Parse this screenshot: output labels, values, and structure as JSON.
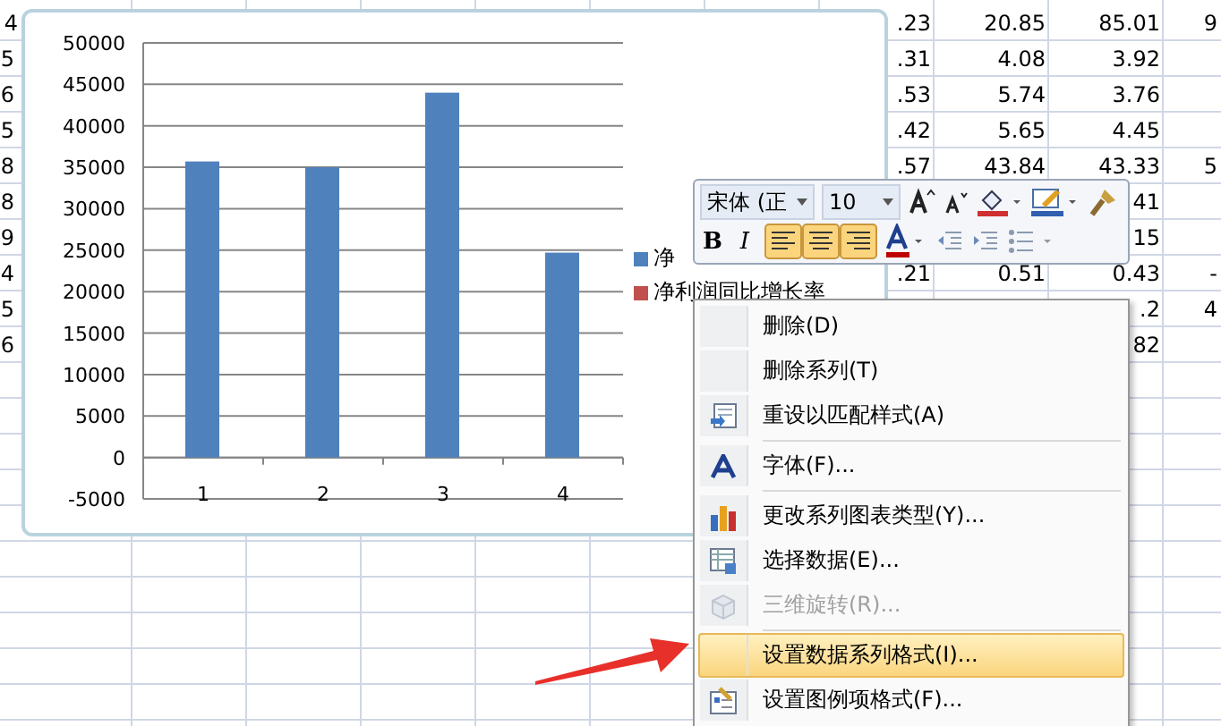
{
  "sheet": {
    "rows": [
      {
        "column_1": "4",
        "column_2": ".23",
        "column_3": "20.85",
        "column_4": "85.01",
        "column_5": "9"
      },
      {
        "column_1": "5",
        "column_2": ".31",
        "column_3": "4.08",
        "column_4": "3.92"
      },
      {
        "column_1": "6",
        "column_2": ".53",
        "column_3": "5.74",
        "column_4": "3.76"
      },
      {
        "column_1": "5",
        "column_2": ".42",
        "column_3": "5.65",
        "column_4": "4.45"
      },
      {
        "column_1": "8",
        "column_2": ".57",
        "column_3": "43.84",
        "column_4": "43.33",
        "column_5": "5"
      },
      {
        "column_1": "8",
        "column_4": "41"
      },
      {
        "column_1": "9",
        "column_4": "15"
      },
      {
        "column_1": "4",
        "column_2": ".21",
        "column_3": "0.51",
        "column_4": "0.43",
        "column_5": "-"
      },
      {
        "column_1": "5",
        "column_4": ".2",
        "column_5": "4"
      },
      {
        "column_1": "6",
        "column_4": "82"
      }
    ]
  },
  "chart": {
    "chart_data": {
      "type": "bar",
      "grid": true,
      "categories": [
        "1",
        "2",
        "3",
        "4"
      ],
      "series": [
        {
          "name": "净",
          "color": "#4f81bd",
          "values": [
            35700,
            35000,
            44000,
            24700
          ]
        },
        {
          "name": "净利润同比增长率",
          "color": "#c0504d",
          "values": [
            null,
            null,
            null,
            null
          ]
        }
      ],
      "ylim": [
        -5000,
        50000
      ],
      "yticks": [
        -5000,
        0,
        5000,
        10000,
        15000,
        20000,
        25000,
        30000,
        35000,
        40000,
        45000,
        50000
      ]
    }
  },
  "mini_toolbar": {
    "font": "宋体 (正",
    "size": "10",
    "bold": "B",
    "italic": "I",
    "align": [
      {
        "selected": true
      },
      {
        "selected": true
      },
      {
        "selected": true
      }
    ]
  },
  "context_menu": {
    "groups": [
      [
        {
          "label": "删除(D)",
          "disabled": false,
          "selected": false
        },
        {
          "label": "删除系列(T)",
          "disabled": false,
          "selected": false
        },
        {
          "label": "重设以匹配样式(A)",
          "disabled": false,
          "selected": false
        }
      ],
      [
        {
          "label": "字体(F)...",
          "disabled": false,
          "selected": false
        }
      ],
      [
        {
          "label": "更改系列图表类型(Y)...",
          "disabled": false,
          "selected": false
        },
        {
          "label": "选择数据(E)...",
          "disabled": false,
          "selected": false
        },
        {
          "label": "三维旋转(R)...",
          "disabled": true,
          "selected": false
        }
      ],
      [
        {
          "label": "设置数据系列格式(I)...",
          "disabled": false,
          "selected": true
        },
        {
          "label": "设置图例项格式(F)...",
          "disabled": false,
          "selected": false
        }
      ]
    ]
  }
}
